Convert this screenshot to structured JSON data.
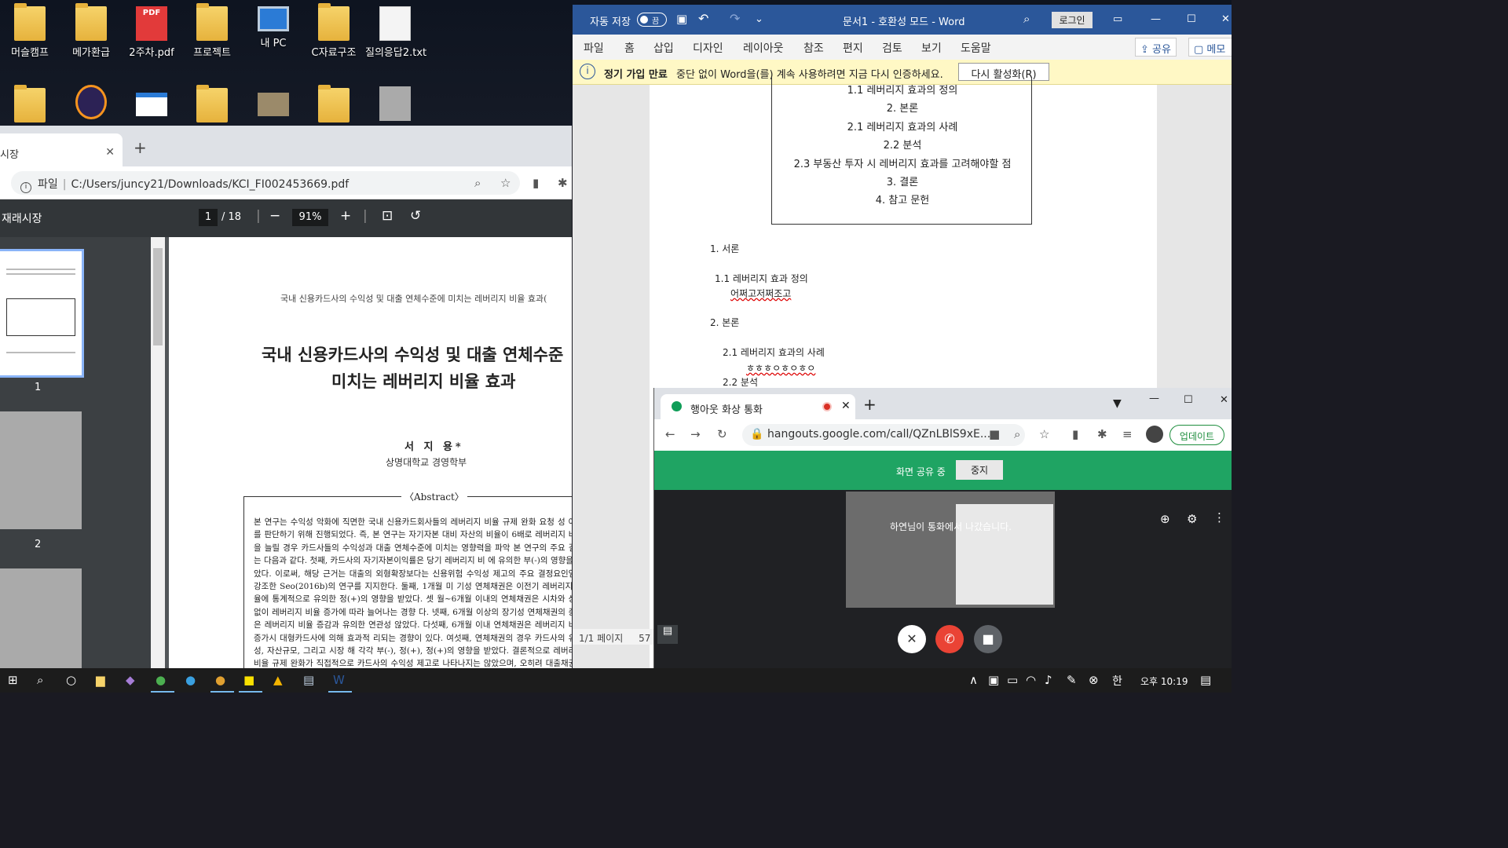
{
  "desktop": {
    "icons": [
      {
        "label": "머슬캠프"
      },
      {
        "label": "메가환급"
      },
      {
        "label": "2주차.pdf"
      },
      {
        "label": "프로젝트"
      },
      {
        "label": "내 PC"
      },
      {
        "label": "C자료구조"
      },
      {
        "label": "질의응답2.txt"
      }
    ],
    "pdf_icon_text": "PDF"
  },
  "pdf_window": {
    "tab_title": "시장",
    "address_label": "파일",
    "address_url": "C:/Users/juncy21/Downloads/KCI_FI002453669.pdf",
    "doc_title": "재래시장",
    "page_current": "1",
    "page_total": "/ 18",
    "zoom": "91%",
    "thumb_numbers": [
      "1",
      "2"
    ],
    "page": {
      "running_header": "국내 신용카드사의 수익성 및 대출 연체수준에 미치는 레버리지 비율 효과(",
      "title_line1": "국내 신용카드사의 수익성 및 대출 연체수준",
      "title_line2": "미치는 레버리지 비율 효과",
      "author": "서 지 용*",
      "affiliation": "상명대학교 경영학부",
      "abstract_title": "〈Abstract〉",
      "abstract_text": "본 연구는 수익성 악화에 직면한 국내 신용카드회사들의 레버리지 비율 규제 완화 요청 성 여부를 판단하기 위해 진행되었다. 즉, 본 연구는 자기자본 대비 자산의 비율이 6배로 레버리지 비율을 늘릴 경우 카드사들의 수익성과 대출 연체수준에 미치는 영향력을 파악 본 연구의 주요 결과는 다음과 같다. 첫째, 카드사의 자기자본이익률은 당기 레버리지 비 에 유의한 부(-)의 영향을 받았다. 이로써, 해당 근거는 대출의 외형확장보다는 신용위험 수익성 제고의 주요 결정요인임을 강조한 Seo(2016b)의 연구를 지지한다. 둘째, 1개월 미 기성 연체채권은 이전기 레버리지 비율에 통계적으로 유의한 정(+)의 영향을 받았다. 셋 월~6개월 이내의 연체채권은 시차와 상관없이 레버리지 비율 증가에 따라 늘어나는 경향 다. 넷째, 6개월 이상의 장기성 연체채권의 증감은 레버리지 비율 증감과 유의한 연관성 않았다. 다섯째, 6개월 이내 연체채권은 레버리지 비율 증가시 대형카드사에 의해 효과적 리되는 경향이 있다. 여섯째, 연체채권의 경우 카드사의 유동성, 자산규모, 그리고 시장 해 각각 부(-), 정(+), 정(+)의 영향을 받았다. 결론적으로 레버리지 비율 규제 완화가 직접적으로 카드사의 수익성 제고로 나타나지는 않았으며, 오히려 대출채권에 대한 효과적 신용위험 관리가"
    }
  },
  "word_window": {
    "autosave_label": "자동 저장",
    "autosave_state": "끔",
    "title": "문서1 - 호환성 모드 - Word",
    "login_label": "로그인",
    "menu": [
      "파일",
      "홈",
      "삽입",
      "디자인",
      "레이아웃",
      "참조",
      "편지",
      "검토",
      "보기",
      "도움말"
    ],
    "share_label": "공유",
    "memo_label": "메모",
    "msg_bold": "정기 가입 만료",
    "msg_text": "중단 없이 Word을(를) 계속 사용하려면 지금 다시 인증하세요.",
    "msg_button": "다시 활성화(R)",
    "toc": [
      "1.1 레버리지 효과의 정의",
      "2. 본론",
      "2.1 레버리지 효과의 사례",
      "2.2 분석",
      "2.3 부동산 투자 시 레버리지 효과를 고려해야할 점",
      "3. 결론",
      "4. 참고 문헌"
    ],
    "body": {
      "h1": "1. 서론",
      "h1_1": "1.1  레버리지 효과 정의",
      "t1": "어쩌고저쩌조고",
      "h2": "2. 본론",
      "h2_1": "2.1  레버리지 효과의 사례",
      "t2": "ㅎㅎㅎㅇㅎㅇㅎㅇ",
      "h2_2": "2.2  분석"
    },
    "status_page": "1/1 페이지",
    "status_words": "57"
  },
  "hangouts_window": {
    "tab_title": "행아웃 화상 통화",
    "url": "hangouts.google.com/call/QZnLBlS9xE...",
    "update_label": "업데이트",
    "sharing_text": "화면 공유 중",
    "stop_label": "중지",
    "left_message": "하연님이 통화에서 나갔습니다."
  },
  "taskbar": {
    "time": "오후 10:19",
    "ime": "한"
  }
}
